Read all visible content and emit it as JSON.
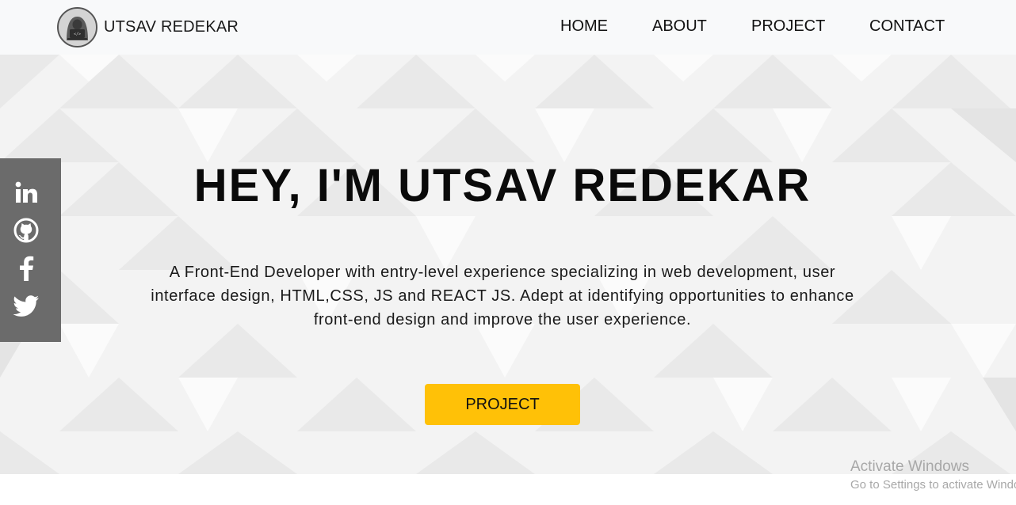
{
  "brand": {
    "name": "UTSAV REDEKAR",
    "logo_icon": "hacker-laptop-avatar-icon"
  },
  "nav": {
    "home": "HOME",
    "about": "ABOUT",
    "project": "PROJECT",
    "contact": "CONTACT"
  },
  "hero": {
    "headline": "HEY, I'M UTSAV REDEKAR",
    "intro_line1": "A Front-End Developer with entry-level experience specializing in web development, user",
    "intro_line2": "interface design, HTML,CSS, JS and REACT JS. Adept at identifying opportunities to enhance",
    "intro_line3": "front-end design and improve the user experience.",
    "cta_label": "PROJECT"
  },
  "social": {
    "items": [
      "linkedin-icon",
      "github-icon",
      "facebook-icon",
      "twitter-icon"
    ]
  },
  "watermark": {
    "title": "Activate Windows",
    "subtitle": "Go to Settings to activate Windows."
  },
  "colors": {
    "navbar_bg": "#f8f9fa",
    "hero_bg": "#f4f4f4",
    "cta_bg": "#ffc107",
    "social_bg": "#6b6b6b"
  }
}
